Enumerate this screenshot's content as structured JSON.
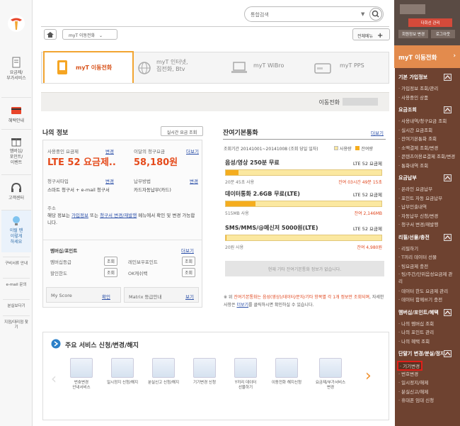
{
  "left_nav": {
    "items": [
      {
        "label": "요금제/\n부가서비스",
        "icon": "document-icon"
      },
      {
        "label": "혜택안내",
        "icon": "card-icon"
      },
      {
        "label": "멤버십/\n포인트/\n이벤트",
        "icon": "gift-icon"
      },
      {
        "label": "고객센터",
        "icon": "headset-icon"
      },
      {
        "label": "이럴 땐\n이렇게\n하세요",
        "icon": "bulb-icon"
      }
    ],
    "small_links": [
      "구비서류\n안내",
      "e-mail\n문의",
      "분실보다기",
      "지점/대리점\n찾기"
    ]
  },
  "header": {
    "search_placeholder": "통합검색",
    "breadcrumb": "myT 이동전화",
    "menu_button": "전체메뉴"
  },
  "tabs": [
    {
      "label": "myT 이동전화",
      "active": true
    },
    {
      "label": "myT 인터넷,\n집전화, Btv",
      "active": false
    },
    {
      "label": "myT WiBro",
      "active": false
    },
    {
      "label": "myT PPS",
      "active": false
    }
  ],
  "page_bar": {
    "label": "이동전화"
  },
  "my_info": {
    "heading": "나의 정보",
    "realtime_button": "실시간 요금 조회",
    "plan_label": "사용중인 요금제",
    "plan_change": "변경",
    "plan_value": "LTE 52 요금제..",
    "bill_label": "이달의 청구요금",
    "bill_more": "더보기",
    "bill_value": "58,180원",
    "billtype_label": "청구서타입",
    "billtype_change": "변경",
    "billtype_value": "스마트 청구서 + e-mail 청구서",
    "pay_label": "납부방법",
    "pay_change": "변경",
    "pay_value": "카드자동납부(카드)",
    "addr_label": "주소",
    "addr_note_1": "해당 정보는",
    "addr_note_link1": "가입정보",
    "addr_note_2": "또는",
    "addr_note_link2": "청구서 변경/재발행",
    "addr_note_3": "메뉴에서 확인 및 변경 가능합니다.",
    "membership_heading": "멤버십/포인트",
    "membership_more": "더보기",
    "membership_grade": "멤버십등급",
    "rainbow": "레인보우포인트",
    "discount": "할인한도",
    "ok": "OK캐쉬백",
    "lookup": "조회",
    "myscore": "My Score",
    "myscore_link": "확인",
    "matrix": "Matrix 등급안내",
    "matrix_link": "보기"
  },
  "remaining": {
    "heading": "잔여기본통화",
    "more": "더보기",
    "period": "조회기간 20141001~20141008 (조회 당일 일자)",
    "legend_used": "사용량",
    "legend_left": "잔여량",
    "blocks": [
      {
        "title": "음성/영상 250분 무료",
        "plan": "LTE 52 요금제",
        "used": "20분 45초 사용",
        "left": "잔여 03시간 49분 15초",
        "fill": 0.08
      },
      {
        "title": "데이터통화 2.6GB 무료(LTE)",
        "plan": "LTE 52 요금제",
        "used": "515MB 사용",
        "left": "잔여 2,146MB",
        "fill": 0.19
      },
      {
        "title": "SMS/MMS/@메신저 5000원(LTE)",
        "plan": "LTE 52 요금제",
        "used": "20원 사용",
        "left": "잔여 4,980원",
        "fill": 0.004
      }
    ],
    "no_other": "현재 기타 잔여기본통화 정보가 없습니다.",
    "note_1": "※ 위",
    "note_red": "잔여기본통화는 음성(영상)/데이터/문자/기타 항목별 각 1개 정보만 조회되며",
    "note_2": ", 자세한 사항은",
    "note_link": "더보기",
    "note_3": "를 클릭하시면 확인하실 수 있습니다."
  },
  "services": {
    "heading": "주요 서비스 신청/변경/해지",
    "items": [
      "번호변경\n안내서비스",
      "일시정지 신청/해지",
      "분실신고 신청/해지",
      "기기변경 신청",
      "T끼리 데이터\n선물하기",
      "이동전화 해지신청",
      "요금제/부가서비스\n변경"
    ]
  },
  "right_panel": {
    "user_button_1": "다회선 관리",
    "user_button_2": "회원정보 변경",
    "user_button_3": "로그아웃",
    "title": "myT 이동전화",
    "sections": [
      {
        "label": "기본 가입정보",
        "items": [
          "가입정보 조회/관리",
          "사용중인 상품"
        ]
      },
      {
        "label": "요금조회",
        "items": [
          "사용내역/청구요금 조회",
          "실시간 요금조회",
          "잔여기본통화 조회",
          "소액결제 조회/변경",
          "콘텐츠이용료결제 조회/변경",
          "통화내역 조회"
        ]
      },
      {
        "label": "요금납부",
        "items": [
          "온라인 요금납부",
          "포인트 자동 요금납부",
          "납부인출내역",
          "자동납부 신청/변경",
          "청구서 변경/재발행"
        ]
      },
      {
        "label": "리필/선물/충전",
        "items": [
          "리필하기",
          "T끼리 데이터 선물",
          "팅요금제 충전",
          "팅/주간/단위음성요금제 관리",
          "데이터 한도 요금제 관리",
          "데이터 함께쓰기 충전"
        ]
      },
      {
        "label": "멤버십/포인트/혜택",
        "items": [
          "나의 멤버십 조회",
          "나의 포인트 관리",
          "나의 혜택 조회"
        ]
      },
      {
        "label": "단말기 변경/분실/정지",
        "items": [
          "기기변경",
          "번호변경",
          "일시정지/해제",
          "분실신고/해제",
          "휴대폰 임대 신청"
        ]
      }
    ]
  },
  "colors": {
    "accent": "#e54b1c",
    "tab_border": "#f2a531",
    "sidebar_bg": "#6e4230",
    "sidebar_head": "#e38b4d"
  }
}
